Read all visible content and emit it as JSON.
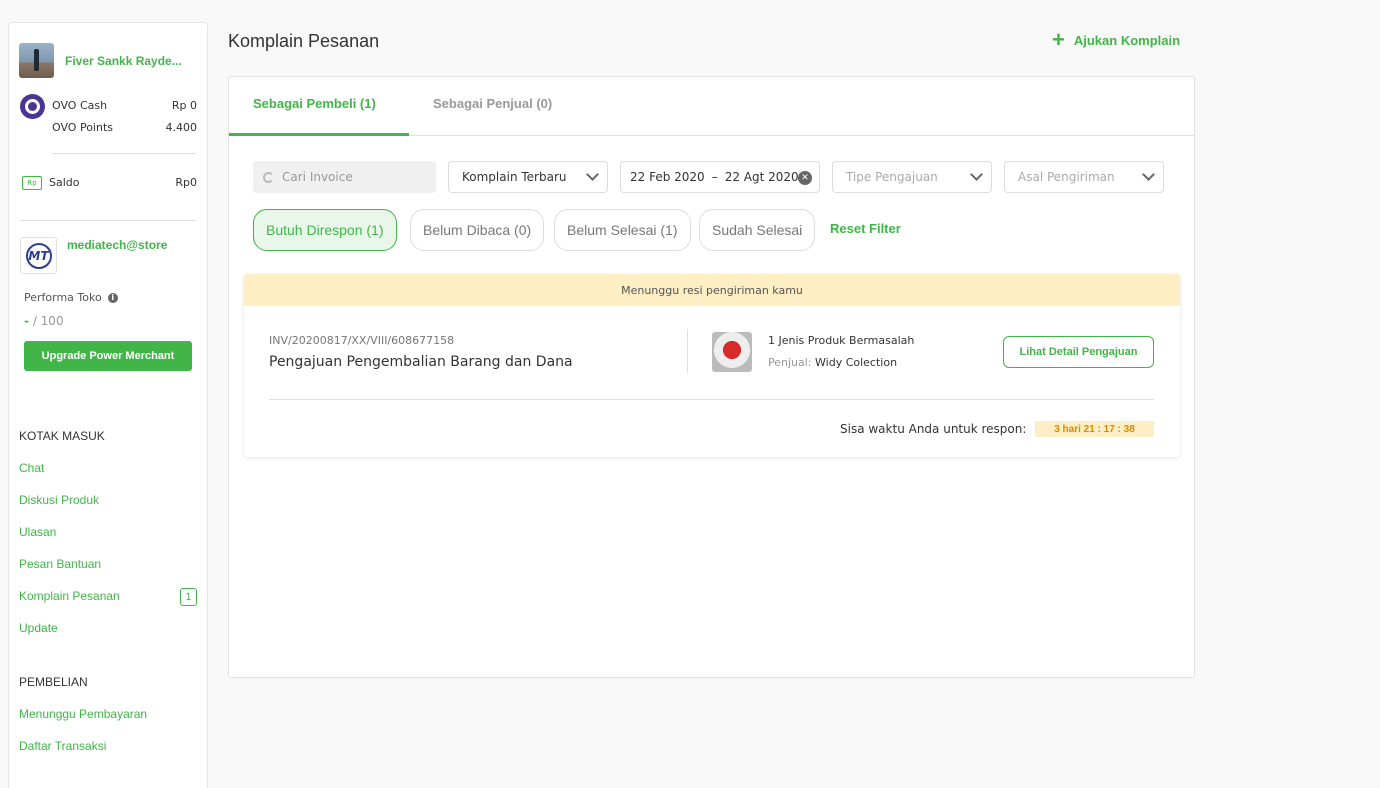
{
  "sidebar": {
    "profile_name": "Fiver Sankk Rayde...",
    "ovo_cash_label": "OVO Cash",
    "ovo_cash_value": "Rp 0",
    "ovo_points_label": "OVO Points",
    "ovo_points_value": "4.400",
    "saldo_label": "Saldo",
    "saldo_value": "Rp0",
    "saldo_icon_text": "Rp",
    "shop_logo_text": "MT",
    "shop_name": "mediatech@store",
    "performa_label": "Performa Toko",
    "performa_score_dash": "-",
    "performa_score_max": "/ 100",
    "upgrade_button": "Upgrade Power Merchant",
    "inbox_title": "KOTAK MASUK",
    "inbox_items": [
      "Chat",
      "Diskusi Produk",
      "Ulasan",
      "Pesan Bantuan",
      "Komplain Pesanan",
      "Update"
    ],
    "komplain_badge": "1",
    "purchase_title": "PEMBELIAN",
    "purchase_items": [
      "Menunggu Pembayaran",
      "Daftar Transaksi"
    ]
  },
  "header": {
    "title": "Komplain Pesanan",
    "add_complaint": "Ajukan Komplain"
  },
  "tabs": [
    {
      "label": "Sebagai Pembeli (1)",
      "active": true
    },
    {
      "label": "Sebagai Penjual (0)",
      "active": false
    }
  ],
  "filters": {
    "search_placeholder": "Cari Invoice",
    "sort_value": "Komplain Terbaru",
    "date_start": "22 Feb 2020",
    "date_separator": "–",
    "date_end": "22 Agt 2020",
    "type_placeholder": "Tipe Pengajuan",
    "origin_placeholder": "Asal Pengiriman"
  },
  "chips": [
    "Butuh Direspon (1)",
    "Belum Dibaca (0)",
    "Belum Selesai (1)",
    "Sudah Selesai"
  ],
  "reset_filter": "Reset Filter",
  "complaint": {
    "banner": "Menunggu resi pengiriman kamu",
    "invoice": "INV/20200817/XX/VIII/608677158",
    "title": "Pengajuan Pengembalian Barang dan Dana",
    "product_count": "1 Jenis Produk Bermasalah",
    "seller_label": "Penjual:",
    "seller_name": "Widy Colection",
    "detail_button": "Lihat Detail Pengajuan",
    "response_label": "Sisa waktu Anda untuk respon:",
    "response_timer": "3 hari 21 : 17 : 38"
  },
  "colors": {
    "accent": "#42b549",
    "banner_bg": "#fdeec4",
    "timer_text": "#d68b00",
    "ovo_purple": "#4c3494"
  }
}
